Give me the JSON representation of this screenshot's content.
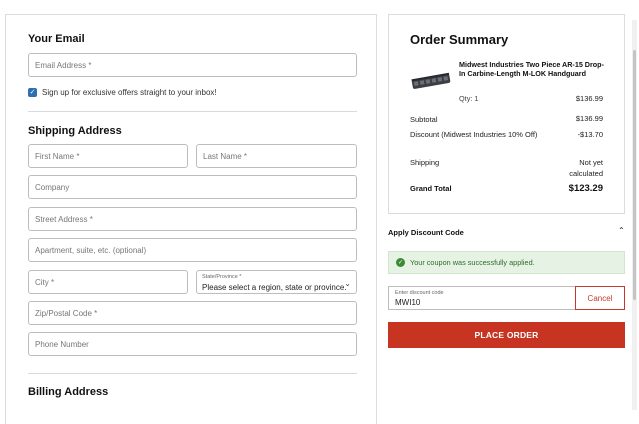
{
  "contact": {
    "title": "Your Email",
    "email_placeholder": "Email Address *",
    "newsletter_label": "Sign up for exclusive offers straight to your inbox!"
  },
  "shipping": {
    "title": "Shipping Address",
    "first_name": "First Name *",
    "last_name": "Last Name *",
    "company": "Company",
    "street": "Street Address *",
    "apartment": "Apartment, suite, etc. (optional)",
    "city": "City *",
    "state_label": "State/Province *",
    "state_value": "Please select a region, state or province.",
    "zip": "Zip/Postal Code *",
    "phone": "Phone Number"
  },
  "billing": {
    "title": "Billing Address"
  },
  "summary": {
    "title": "Order Summary",
    "product_name": "Midwest Industries Two Piece AR-15 Drop-In Carbine-Length M-LOK Handguard",
    "qty": "Qty: 1",
    "product_price": "$136.99",
    "subtotal_label": "Subtotal",
    "subtotal_value": "$136.99",
    "discount_label": "Discount (Midwest Industries 10% Off)",
    "discount_value": "-$13.70",
    "shipping_label": "Shipping",
    "shipping_value": "Not yet calculated",
    "grand_total_label": "Grand Total",
    "grand_total_value": "$123.29"
  },
  "discount": {
    "title": "Apply Discount Code",
    "success_message": "Your coupon was successfully applied.",
    "code_label": "Enter discount code",
    "code_value": "MWI10",
    "cancel_label": "Cancel"
  },
  "place_order_label": "PLACE ORDER",
  "colors": {
    "accent": "#c73422",
    "success_bg": "#e6f3e4",
    "checkbox": "#2f6fb0"
  }
}
